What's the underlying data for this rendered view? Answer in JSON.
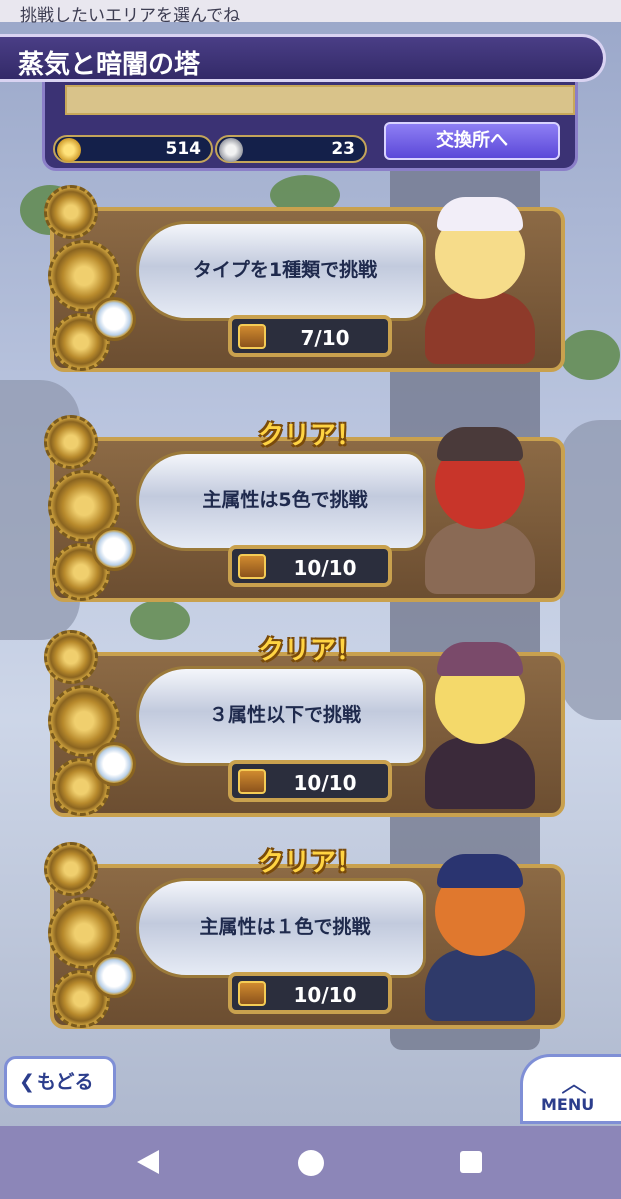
{
  "hint": "挑戦したいエリアを選んでね",
  "title": "蒸気と暗闇の塔",
  "currency": {
    "gold": "514",
    "silver": "23",
    "exchange_label": "交換所へ"
  },
  "cards": [
    {
      "label": "タイプを1種類で挑戦",
      "progress": "7/10",
      "badge": ""
    },
    {
      "label": "主属性は5色で挑戦",
      "progress": "10/10",
      "badge": "クリア！"
    },
    {
      "label": "３属性以下で挑戦",
      "progress": "10/10",
      "badge": "クリア！"
    },
    {
      "label": "主属性は１色で挑戦",
      "progress": "10/10",
      "badge": "クリア！"
    }
  ],
  "nav": {
    "back_label": "もどる",
    "menu_label": "MENU"
  },
  "icons": {
    "gold": "gold-coin-icon",
    "silver": "silver-coin-icon",
    "chest": "treasure-chest-icon"
  },
  "colors": {
    "title_bg": "#3b3274",
    "exchange_button": "#6d5ae6",
    "clear_badge": "#ffd443",
    "counter_bg": "#2b2e3d",
    "frame_gold": "#c9a14e"
  }
}
